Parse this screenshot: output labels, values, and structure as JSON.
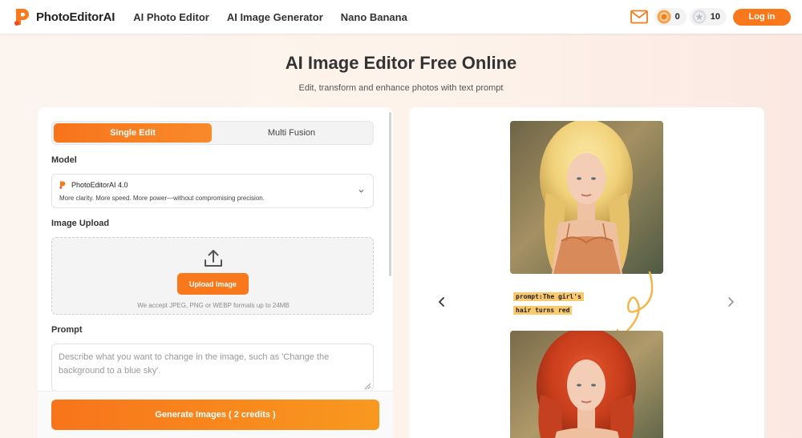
{
  "nav": {
    "brand": "PhotoEditorAI",
    "links": [
      "AI Photo Editor",
      "AI Image Generator",
      "Nano Banana"
    ],
    "credits_orange": "0",
    "credits_silver": "10",
    "login_label": "Log in"
  },
  "hero": {
    "title": "AI Image Editor Free Online",
    "subtitle": "Edit, transform and enhance photos with text prompt"
  },
  "editor": {
    "tabs": [
      "Single Edit",
      "Multi Fusion"
    ],
    "active_tab": "Single Edit",
    "model_label": "Model",
    "model_name": "PhotoEditorAI 4.0",
    "model_desc": "More clarity. More speed. More power—without compromising precision.",
    "upload_label": "Image Upload",
    "upload_button": "Upload Image",
    "upload_hint": "We accept JPEG, PNG or WEBP formats up to 24MB",
    "prompt_label": "Prompt",
    "prompt_placeholder": "Describe what you want to change in the image, such as 'Change the background to a blue sky'.",
    "prompt_value": "",
    "generate_label": "Generate Images ( 2 credits )"
  },
  "preview": {
    "prompt_line1": "prompt:The girl's",
    "prompt_line2": "hair turns red"
  },
  "colors": {
    "accent": "#f8781b",
    "prompt_highlight": "#f9c96e",
    "arrow": "#f5b54a"
  },
  "icons": [
    "logo-icon",
    "mail-icon",
    "orange-coin-icon",
    "silver-coin-icon",
    "chevron-down-icon",
    "upload-icon",
    "chevron-left-icon",
    "chevron-right-icon",
    "curly-arrow-icon",
    "resize-grip-icon"
  ]
}
